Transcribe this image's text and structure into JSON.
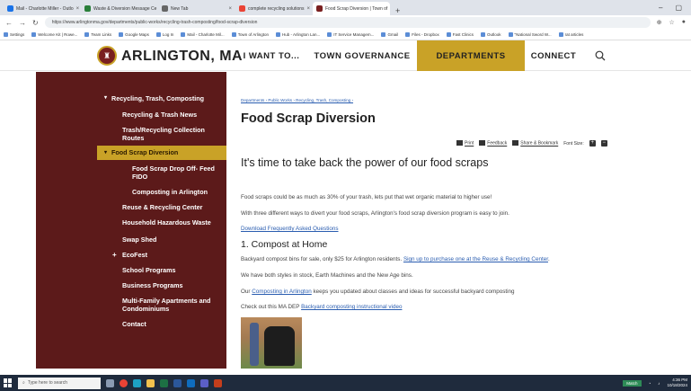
{
  "browser": {
    "tabs": [
      {
        "label": "Mail - Charlotte Miller - Outlo",
        "active": false
      },
      {
        "label": "Waste & Diversion Message Ce",
        "active": false
      },
      {
        "label": "New Tab",
        "active": false
      },
      {
        "label": "complete recycling solutions",
        "active": false
      },
      {
        "label": "Food Scrap Diversion | Town of",
        "active": true
      }
    ],
    "new_tab": "+",
    "url": "https://www.arlingtonma.gov/departments/public-works/recycling-trash-composting/food-scrap-diversion",
    "bookmarks": [
      "Settings",
      "Welcome Kit | Rowe...",
      "Team Links",
      "Google Maps",
      "Log In",
      "Mail - Charlotte Mil...",
      "Town of Arlington",
      "Hub - Arlington Lan...",
      "IT Service Managem...",
      "Gmail",
      "Files - Dropbox",
      "Fast Clinics",
      "Outlook",
      "\"National Sword W...",
      "rat articles"
    ]
  },
  "site": {
    "seal_glyph": "♜",
    "name": "ARLINGTON, MA",
    "nav": [
      "I WANT TO...",
      "TOWN GOVERNANCE",
      "DEPARTMENTS",
      "CONNECT"
    ],
    "active_nav": "DEPARTMENTS",
    "accent_color": "#c9a227",
    "sidebar_color": "#5c1a1a"
  },
  "sidebar": {
    "items": [
      {
        "label": "Recycling, Trash, Composting",
        "arrow": "▾"
      },
      {
        "label": "Recycling & Trash News",
        "arrow": ""
      },
      {
        "label": "Trash/Recycling Collection",
        "label2": "Routes",
        "arrow": ""
      },
      {
        "label": "Food Scrap Diversion",
        "arrow": "▾",
        "active": true
      },
      {
        "label": "Food Scrap Drop Off- Feed",
        "label2": "FIDO",
        "arrow": ""
      },
      {
        "label": "Composting in Arlington",
        "arrow": ""
      },
      {
        "label": "Reuse & Recycling Center",
        "arrow": ""
      },
      {
        "label": "Household Hazardous Waste",
        "arrow": ""
      },
      {
        "label": "Swap Shed",
        "arrow": ""
      },
      {
        "label": "EcoFest",
        "arrow": "+"
      },
      {
        "label": "School Programs",
        "arrow": ""
      },
      {
        "label": "Business Programs",
        "arrow": ""
      },
      {
        "label": "Multi-Family Apartments and",
        "label2": "Condominiums",
        "arrow": ""
      },
      {
        "label": "Contact",
        "arrow": ""
      }
    ]
  },
  "content": {
    "breadcrumb": "Departments › Public Works › Recycling, Trash, Composting ›",
    "title": "Food Scrap Diversion",
    "tools": {
      "print": "Print",
      "feedback": "Feedback",
      "share": "Share & Bookmark",
      "font_size": "Font Size:",
      "plus": "+",
      "minus": "−"
    },
    "headline": "It's time to take back the power of our food scraps",
    "p1": "Food scraps could be as much as 30% of your trash, lets put that wet organic material to higher use!",
    "p2": "With three different ways to divert your food scraps, Arlington's food scrap diversion program is easy to join.",
    "faq_link": "Download Frequently Asked Questions",
    "section1": "1. Compost at Home",
    "p3_text": "Backyard compost bins for sale, only $25 for Arlington residents.",
    "p3_link": "Sign up to purchase one at the Reuse & Recycling Center",
    "p3_end": ".",
    "p4": "We have both styles in stock, Earth Machines and the New Age bins.",
    "p5_start": "Our",
    "p5_link": "Composting in Arlington",
    "p5_end": "keeps you updated about classes and ideas for successful backyard composting",
    "p6_start": "Check out this MA DEP",
    "p6_link": "Backyard composting instructional video"
  },
  "taskbar": {
    "search_placeholder": "Type here to search",
    "weather": "Match",
    "time": "4:36 PM",
    "date": "10/18/2024"
  }
}
